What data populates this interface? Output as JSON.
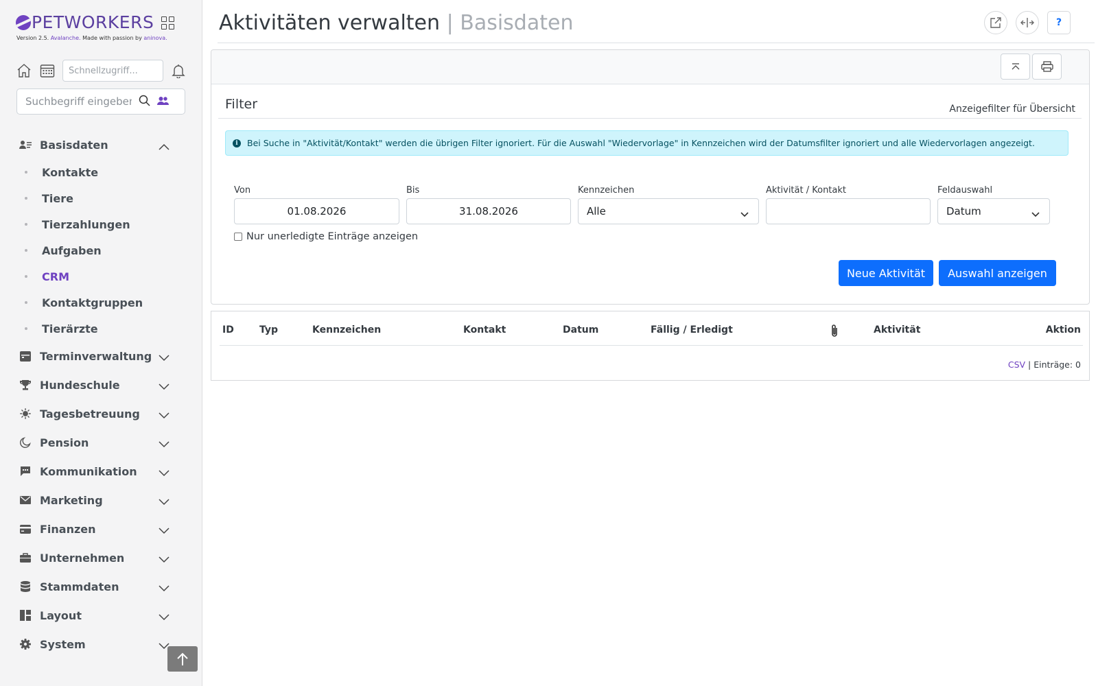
{
  "brand": {
    "name": "PETWORKERS",
    "version_prefix": "Version 2.5.",
    "version_name": "Avalanche.",
    "version_made": "Made with passion by",
    "version_company": "aninova."
  },
  "quickbar": {
    "quick_placeholder": "Schnellzugriff...",
    "search_placeholder": "Suchbegriff eingeben"
  },
  "sidebar": {
    "sections": [
      {
        "label": "Basisdaten",
        "icon": "contacts-icon",
        "expanded": true
      },
      {
        "label": "Terminverwaltung",
        "icon": "calendar-icon"
      },
      {
        "label": "Hundeschule",
        "icon": "trophy-icon"
      },
      {
        "label": "Tagesbetreuung",
        "icon": "sun-icon"
      },
      {
        "label": "Pension",
        "icon": "moon-icon"
      },
      {
        "label": "Kommunikation",
        "icon": "chat-icon"
      },
      {
        "label": "Marketing",
        "icon": "envelope-icon"
      },
      {
        "label": "Finanzen",
        "icon": "credit-card-icon"
      },
      {
        "label": "Unternehmen",
        "icon": "briefcase-icon"
      },
      {
        "label": "Stammdaten",
        "icon": "database-icon"
      },
      {
        "label": "Layout",
        "icon": "layout-icon"
      },
      {
        "label": "System",
        "icon": "gear-icon"
      }
    ],
    "sub_items": [
      "Kontakte",
      "Tiere",
      "Tierzahlungen",
      "Aufgaben",
      "CRM",
      "Kontaktgruppen",
      "Tierärzte"
    ],
    "active_sub_item": "CRM"
  },
  "header": {
    "title": "Aktivitäten verwalten",
    "separator": "|",
    "subtitle": "Basisdaten",
    "help_label": "?"
  },
  "filter": {
    "title": "Filter",
    "right_label": "Anzeigefilter für Übersicht",
    "info": "Bei Suche in \"Aktivität/Kontakt\" werden die übrigen Filter ignoriert. Für die Auswahl \"Wiedervorlage\" in Kennzeichen wird der Datumsfilter ignoriert und alle Wiedervorlagen angezeigt.",
    "von_label": "Von",
    "von_value": "01.08.2026",
    "bis_label": "Bis",
    "bis_value": "31.08.2026",
    "kennzeichen_label": "Kennzeichen",
    "kennzeichen_value": "Alle",
    "aktivitaet_label": "Aktivität / Kontakt",
    "aktivitaet_value": "",
    "feldauswahl_label": "Feldauswahl",
    "feldauswahl_value": "Datum",
    "checkbox_label": "Nur unerledigte Einträge anzeigen",
    "checkbox_checked": false,
    "new_button": "Neue Aktivität",
    "show_button": "Auswahl anzeigen"
  },
  "table": {
    "columns": [
      "ID",
      "Typ",
      "Kennzeichen",
      "Kontakt",
      "Datum",
      "Fällig / Erledigt",
      "paperclip-icon",
      "Aktivität",
      "Aktion"
    ],
    "rows": [],
    "csv_label": "CSV",
    "footer_text": "| Einträge: 0"
  },
  "colors": {
    "brand": "#6f42c1",
    "primary": "#0d6efd",
    "info_bg": "#cff4fc",
    "info_text": "#055160"
  }
}
